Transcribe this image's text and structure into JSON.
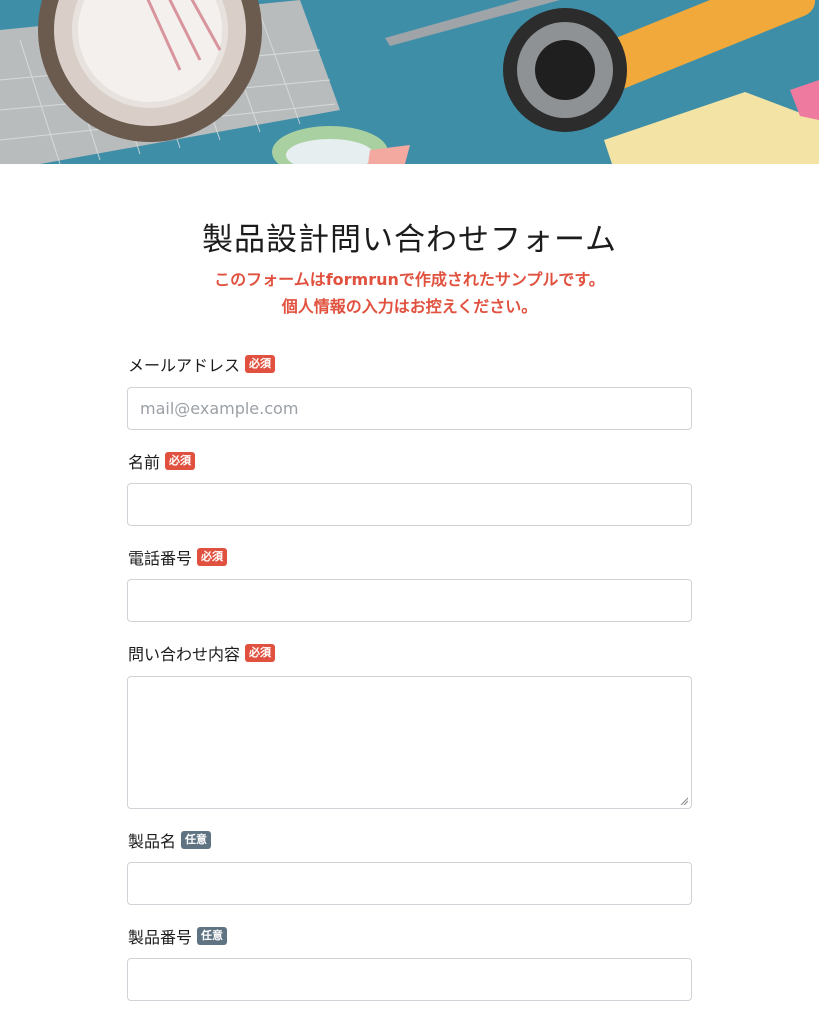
{
  "form": {
    "title": "製品設計問い合わせフォーム",
    "notice_line1": "このフォームはformrunで作成されたサンプルです。",
    "notice_line2": "個人情報の入力はお控えください。"
  },
  "badges": {
    "required": "必須",
    "optional": "任意"
  },
  "fields": [
    {
      "label": "メールアドレス",
      "badge": "必須",
      "placeholder": "mail@example.com",
      "value": ""
    },
    {
      "label": "名前",
      "badge": "必須",
      "placeholder": "",
      "value": ""
    },
    {
      "label": "電話番号",
      "badge": "必須",
      "placeholder": "",
      "value": ""
    },
    {
      "label": "問い合わせ内容",
      "badge": "必須",
      "placeholder": "",
      "value": ""
    },
    {
      "label": "製品名",
      "badge": "任意",
      "placeholder": "",
      "value": ""
    },
    {
      "label": "製品番号",
      "badge": "任意",
      "placeholder": "",
      "value": ""
    }
  ],
  "colors": {
    "accent_required": "#e0523f",
    "badge_optional": "#5f7383",
    "hero_background": "#3f8ea8"
  }
}
